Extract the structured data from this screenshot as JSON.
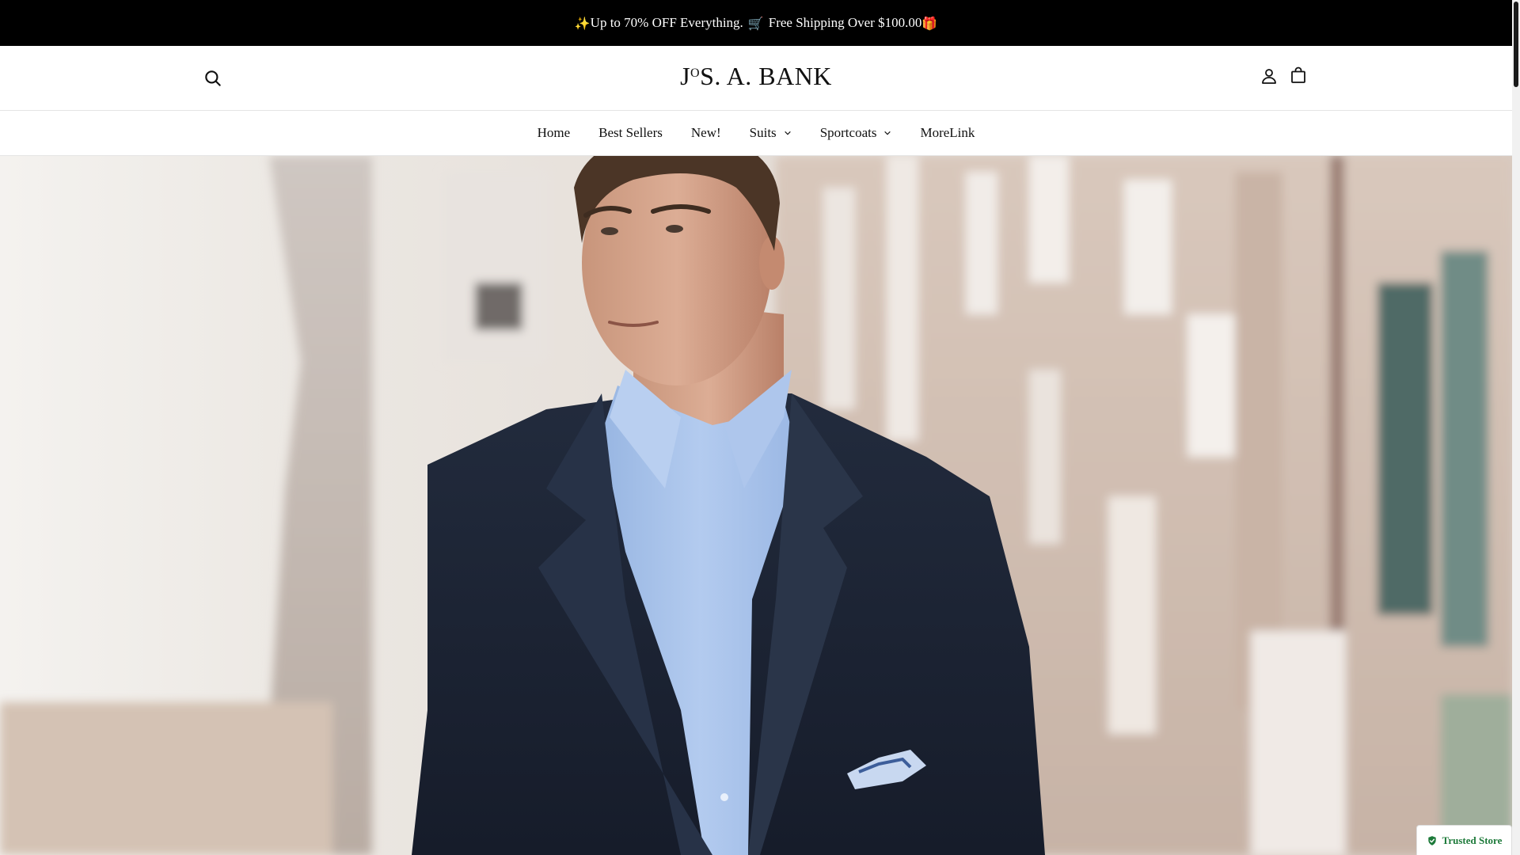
{
  "announcement": {
    "sparkle": "✨",
    "text1": "Up to 70% OFF Everything.",
    "cart": "🛒",
    "text2": "Free Shipping Over $100.00",
    "gift": "🎁"
  },
  "header": {
    "logo_text_a": "J",
    "logo_sup": "O",
    "logo_text_b": "S. A. BANK",
    "icons": {
      "search": "search-icon",
      "account": "user-icon",
      "cart": "shopping-bag-icon"
    }
  },
  "nav": {
    "items": [
      {
        "label": "Home",
        "has_dropdown": false
      },
      {
        "label": "Best Sellers",
        "has_dropdown": false
      },
      {
        "label": "New!",
        "has_dropdown": false
      },
      {
        "label": "Suits",
        "has_dropdown": true
      },
      {
        "label": "Sportcoats",
        "has_dropdown": true
      },
      {
        "label": "MoreLink",
        "has_dropdown": false
      }
    ]
  },
  "badge": {
    "label": "Trusted Store",
    "color": "#1d7a3a"
  },
  "colors": {
    "announcement_bg": "#000000",
    "suit": "#1c2436",
    "shirt": "#a9c4ea"
  }
}
